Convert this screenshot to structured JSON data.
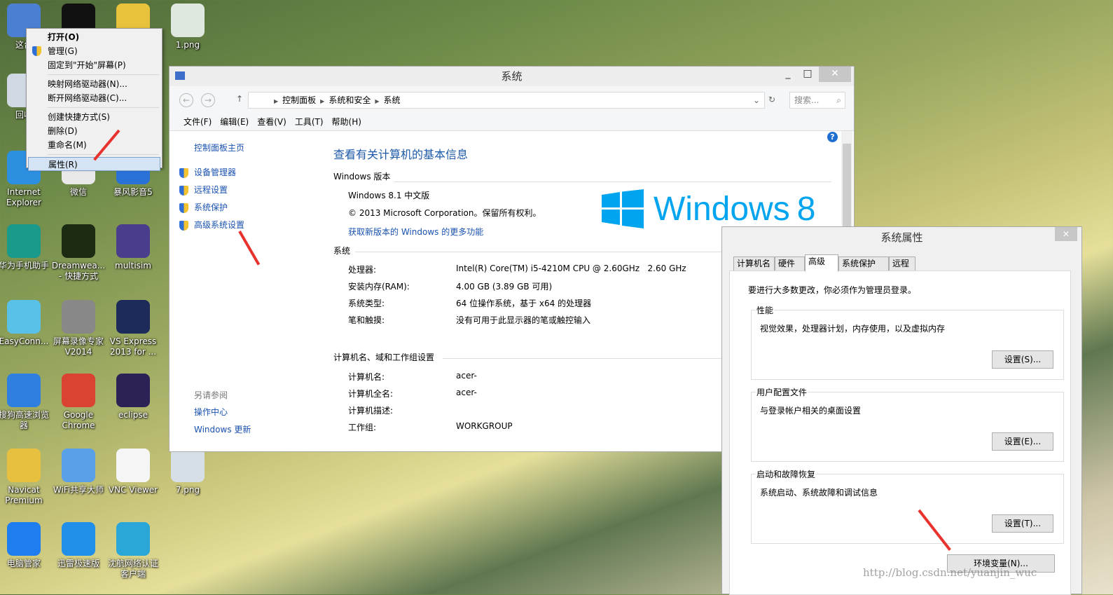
{
  "desktop": {
    "icons": [
      {
        "label": "这台",
        "color": "#4a7fd1",
        "col": 0,
        "row": 0
      },
      {
        "label": "",
        "color": "#111",
        "col": 1,
        "row": 0
      },
      {
        "label": "",
        "color": "#e7c23a",
        "col": 2,
        "row": 0
      },
      {
        "label": "1.png",
        "color": "#dfe8df",
        "col": 3,
        "row": 0
      },
      {
        "label": "回收",
        "color": "#cfd8e3",
        "col": 0,
        "row": 1
      },
      {
        "label": "Internet Explorer",
        "color": "#2d8fe0",
        "col": 0,
        "row": 2
      },
      {
        "label": "微信",
        "color": "#e9e9e9",
        "col": 1,
        "row": 2
      },
      {
        "label": "暴风影音5",
        "color": "#2a72d8",
        "col": 2,
        "row": 2
      },
      {
        "label": "华为手机助手",
        "color": "#1a9a8a",
        "col": 0,
        "row": 3
      },
      {
        "label": "Dreamwea... - 快捷方式",
        "color": "#1b2a12",
        "col": 1,
        "row": 3
      },
      {
        "label": "multisim",
        "color": "#4a3d8c",
        "col": 2,
        "row": 3
      },
      {
        "label": "EasyConn...",
        "color": "#59c1e8",
        "col": 0,
        "row": 4
      },
      {
        "label": "屏幕录像专家 V2014",
        "color": "#888",
        "col": 1,
        "row": 4
      },
      {
        "label": "VS Express 2013 for ...",
        "color": "#1c2b5a",
        "col": 2,
        "row": 4
      },
      {
        "label": "搜狗高速浏览器",
        "color": "#2f7fe0",
        "col": 0,
        "row": 5
      },
      {
        "label": "Google Chrome",
        "color": "#d9432f",
        "col": 1,
        "row": 5
      },
      {
        "label": "eclipse",
        "color": "#2c2255",
        "col": 2,
        "row": 5
      },
      {
        "label": "Navicat Premium",
        "color": "#e8c040",
        "col": 0,
        "row": 6
      },
      {
        "label": "WiFi共享大师",
        "color": "#5aa0e8",
        "col": 1,
        "row": 6
      },
      {
        "label": "VNC Viewer",
        "color": "#f5f5f5",
        "col": 2,
        "row": 6
      },
      {
        "label": "7.png",
        "color": "#d6dfe6",
        "col": 3,
        "row": 6
      },
      {
        "label": "电脑管家",
        "color": "#1e7ef0",
        "col": 0,
        "row": 7
      },
      {
        "label": "迅雷极速版",
        "color": "#1f8fe8",
        "col": 1,
        "row": 7
      },
      {
        "label": "沈航网络认证客户端",
        "color": "#2aa6d8",
        "col": 2,
        "row": 7
      }
    ]
  },
  "context_menu": {
    "items": [
      {
        "label": "打开(O)",
        "bold": true
      },
      {
        "label": "管理(G)",
        "shield": true
      },
      {
        "label": "固定到\"开始\"屏幕(P)"
      },
      {
        "sep": true
      },
      {
        "label": "映射网络驱动器(N)..."
      },
      {
        "label": "断开网络驱动器(C)..."
      },
      {
        "sep": true
      },
      {
        "label": "创建快捷方式(S)"
      },
      {
        "label": "删除(D)"
      },
      {
        "label": "重命名(M)"
      },
      {
        "sep": true
      },
      {
        "label": "属性(R)",
        "selected": true
      }
    ]
  },
  "system_window": {
    "title": "系统",
    "minimize": "_",
    "maximize": "□",
    "close": "✕",
    "breadcrumb": [
      "控制面板",
      "系统和安全",
      "系统"
    ],
    "search_placeholder": "搜索...",
    "menu": [
      "文件(F)",
      "编辑(E)",
      "查看(V)",
      "工具(T)",
      "帮助(H)"
    ],
    "left_pane": {
      "home": "控制面板主页",
      "links": [
        "设备管理器",
        "远程设置",
        "系统保护",
        "高级系统设置"
      ],
      "see_also": "另请参阅",
      "see_also_links": [
        "操作中心",
        "Windows 更新"
      ]
    },
    "heading": "查看有关计算机的基本信息",
    "edition_section": "Windows 版本",
    "edition": "Windows 8.1 中文版",
    "copyright": "© 2013 Microsoft Corporation。保留所有权利。",
    "more_features_link": "获取新版本的 Windows 的更多功能",
    "logo_text": "Windows",
    "logo_version": "8",
    "system_section": "系统",
    "system_rows": [
      [
        "处理器:",
        "Intel(R) Core(TM) i5-4210M CPU @ 2.60GHz   2.60 GHz"
      ],
      [
        "安装内存(RAM):",
        "4.00 GB (3.89 GB 可用)"
      ],
      [
        "系统类型:",
        "64 位操作系统，基于 x64 的处理器"
      ],
      [
        "笔和触摸:",
        "没有可用于此显示器的笔或触控输入"
      ]
    ],
    "computer_section": "计算机名、域和工作组设置",
    "computer_rows": [
      [
        "计算机名:",
        "acer-"
      ],
      [
        "计算机全名:",
        "acer-"
      ],
      [
        "计算机描述:",
        ""
      ],
      [
        "工作组:",
        "WORKGROUP"
      ]
    ]
  },
  "properties_dialog": {
    "title": "系统属性",
    "close": "✕",
    "tabs": [
      "计算机名",
      "硬件",
      "高级",
      "系统保护",
      "远程"
    ],
    "active_tab": 2,
    "admin_note": "要进行大多数更改，你必须作为管理员登录。",
    "groups": [
      {
        "title": "性能",
        "desc": "视觉效果，处理器计划，内存使用，以及虚拟内存",
        "button": "设置(S)..."
      },
      {
        "title": "用户配置文件",
        "desc": "与登录帐户相关的桌面设置",
        "button": "设置(E)..."
      },
      {
        "title": "启动和故障恢复",
        "desc": "系统启动、系统故障和调试信息",
        "button": "设置(T)..."
      }
    ],
    "env_button": "环境变量(N)..."
  },
  "watermark": "http://blog.csdn.net/yuanjin_wuc",
  "colors": {
    "link": "#1a52b0",
    "heading": "#1e5aa8",
    "logo": "#00a4ef",
    "arrow": "#e8322e"
  }
}
